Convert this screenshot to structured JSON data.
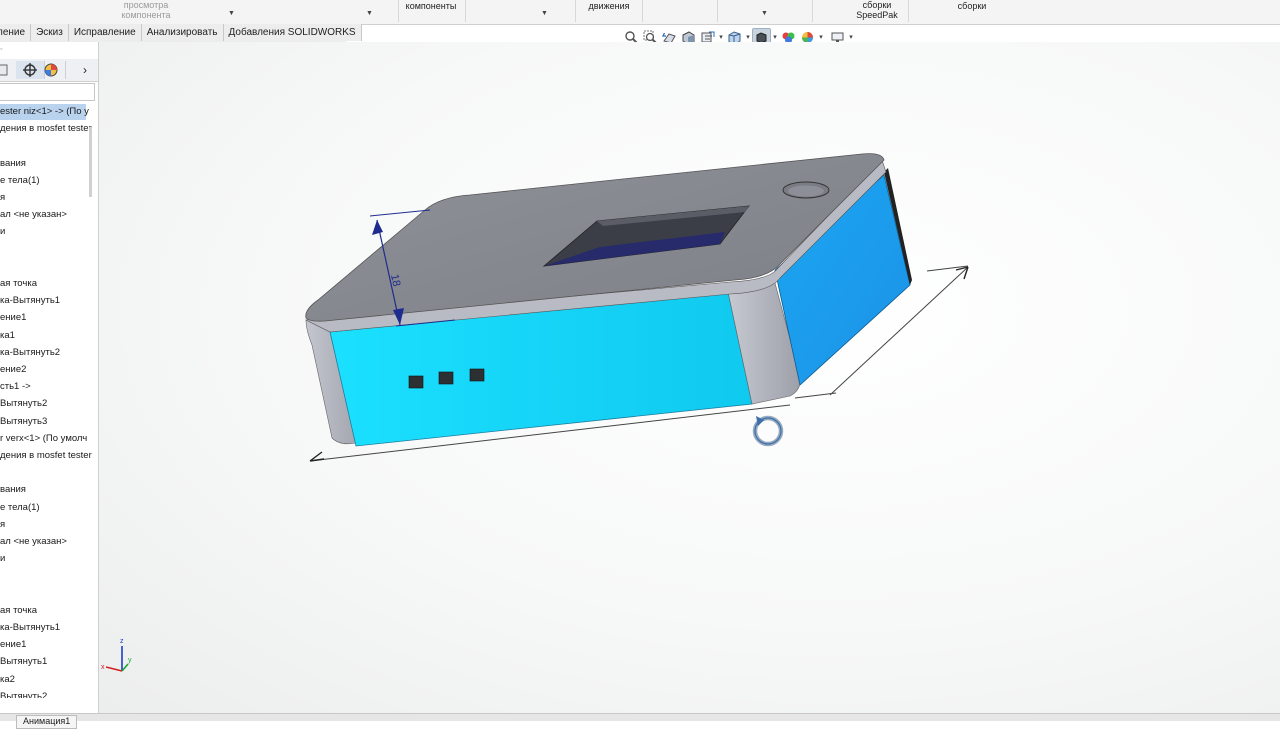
{
  "ribbon": {
    "items": [
      {
        "text": "просмотра\nкомпонента",
        "faded": true
      },
      {
        "text": "компоненты"
      },
      {
        "text": "движения"
      },
      {
        "text": "сборки\nSpeedPak"
      },
      {
        "text": "сборки"
      }
    ]
  },
  "command_tabs": [
    "ление",
    "Эскиз",
    "Исправление",
    "Анализировать",
    "Добавления SOLIDWORKS"
  ],
  "heads_up_toolbar": {
    "icons": [
      "zoom-to-fit-icon",
      "zoom-to-area-icon",
      "previous-view-icon",
      "section-view-icon",
      "dynamic-annotation-icon",
      "view-orientation-icon",
      "display-style-icon",
      "hide-show-items-icon",
      "edit-appearance-icon",
      "apply-scene-icon",
      "view-settings-icon"
    ],
    "active": "display-style-icon"
  },
  "feature_manager": {
    "tabs": [
      "feature-tree-icon",
      "property-manager-icon",
      "configuration-manager-icon",
      "dimxpert-icon",
      "display-manager-icon"
    ],
    "more_label": "›",
    "tree": [
      {
        "label": "ester niz<1> -> (По у",
        "selected": true
      },
      {
        "label": "дения в mosfet tester"
      },
      {
        "label": ""
      },
      {
        "label": "вания"
      },
      {
        "label": "е тела(1)"
      },
      {
        "label": "я"
      },
      {
        "label": "ал <не указан>"
      },
      {
        "label": "и"
      },
      {
        "label": ""
      },
      {
        "label": ""
      },
      {
        "label": "ая точка"
      },
      {
        "label": "ка-Вытянуть1"
      },
      {
        "label": "ение1"
      },
      {
        "label": "ка1"
      },
      {
        "label": "ка-Вытянуть2"
      },
      {
        "label": "ение2"
      },
      {
        "label": "сть1 ->"
      },
      {
        "label": "Вытянуть2"
      },
      {
        "label": "Вытянуть3"
      },
      {
        "label": "r verx<1> (По умолч"
      },
      {
        "label": "дения в mosfet tester"
      },
      {
        "label": ""
      },
      {
        "label": "вания"
      },
      {
        "label": "е тела(1)"
      },
      {
        "label": "я"
      },
      {
        "label": "ал <не указан>"
      },
      {
        "label": "и"
      },
      {
        "label": ""
      },
      {
        "label": ""
      },
      {
        "label": "ая точка"
      },
      {
        "label": "ка-Вытянуть1"
      },
      {
        "label": "ение1"
      },
      {
        "label": "Вытянуть1"
      },
      {
        "label": "ка2"
      },
      {
        "label": "Вытянуть2"
      }
    ]
  },
  "viewport": {
    "dimension_value": "18",
    "triad": {
      "z": "z",
      "x": "x",
      "y": "y"
    },
    "colors": {
      "body_top": "#8a8c95",
      "body_side": "#1ad7f6",
      "body_right": "#1aa8f0",
      "dimension": "#1f2c8f"
    }
  },
  "bottom_tabs": [
    "Анимация1"
  ]
}
